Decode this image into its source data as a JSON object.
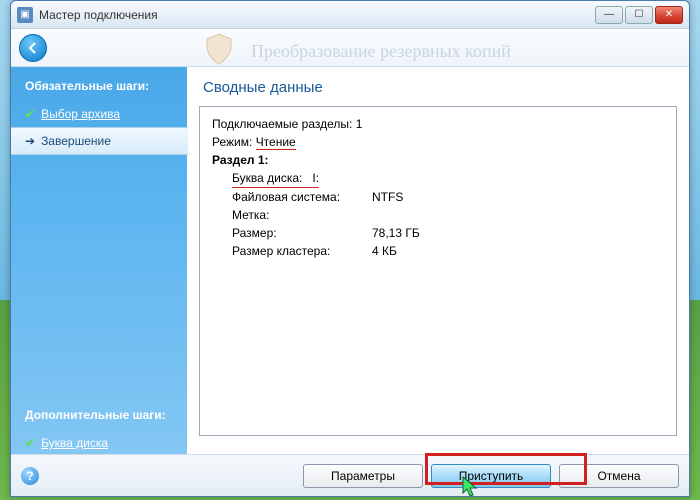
{
  "window": {
    "title": "Мастер подключения"
  },
  "header": {
    "bg_text": "Преобразование резервных копий"
  },
  "sidebar": {
    "required_heading": "Обязательные шаги:",
    "items": [
      {
        "label": "Выбор архива",
        "done": true
      },
      {
        "label": "Завершение",
        "active": true
      }
    ],
    "extra_heading": "Дополнительные шаги:",
    "extra_items": [
      {
        "label": "Буква диска"
      }
    ]
  },
  "main": {
    "heading": "Сводные данные",
    "summary": {
      "line_partitions_label": "Подключаемые разделы:",
      "line_partitions_value": "1",
      "mode_label": "Режим:",
      "mode_value": "Чтение",
      "section": "Раздел 1:",
      "drive_letter_label": "Буква диска:",
      "drive_letter_value": "I:",
      "fs_label": "Файловая система:",
      "fs_value": "NTFS",
      "volume_label_label": "Метка:",
      "volume_label_value": "",
      "size_label": "Размер:",
      "size_value": "78,13 ГБ",
      "cluster_label": "Размер кластера:",
      "cluster_value": "4 КБ"
    }
  },
  "footer": {
    "params": "Параметры",
    "proceed": "Приступить",
    "cancel": "Отмена"
  }
}
